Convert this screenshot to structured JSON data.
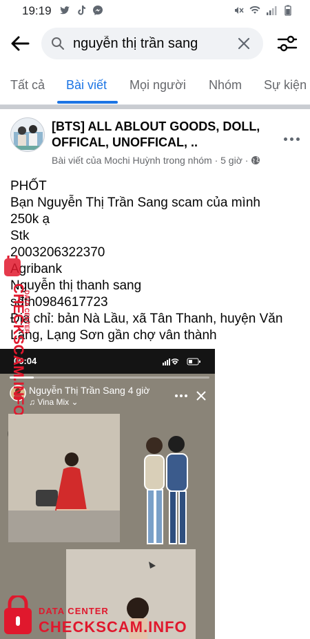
{
  "status_bar": {
    "time": "19:19"
  },
  "search": {
    "value": "nguyễn thị trần sang"
  },
  "tabs": [
    {
      "label": "Tất cả",
      "active": false
    },
    {
      "label": "Bài viết",
      "active": true
    },
    {
      "label": "Mọi người",
      "active": false
    },
    {
      "label": "Nhóm",
      "active": false
    },
    {
      "label": "Sự kiện",
      "active": false
    }
  ],
  "post": {
    "group_name": "[BTS] ALL ABLOUT GOODS, DOLL, OFFICAL, UNOFFICAL, ..",
    "meta": "Bài viết của Mochi Huỳnh trong nhóm · 5 giờ ·",
    "lines": [
      "PHỐT",
      "Bạn Nguyễn Thị Trần Sang scam của mình 250k ạ",
      "Stk",
      "2003206322370",
      "Agribank",
      "Nguyễn thị thanh sang",
      "sđth0984617723",
      "Địa chỉ: bản Nà Lầu, xã Tân Thanh, huyện Văn Lãng, Lạng Sơn gần chợ vân thành"
    ],
    "story": {
      "time": "00:04",
      "author": "Nguyễn Thị Trần Sang",
      "author_time": "4 giờ",
      "music": "♫ Vina Mix",
      "progress": 0.12
    }
  },
  "watermark": {
    "vertical": "CHECKSCAM.INFO",
    "vertical_small": "DATA CENTER",
    "small": "DATA CENTER",
    "big": "CHECKSCAM.INFO"
  },
  "colors": {
    "accent": "#1b74e4",
    "watermark": "#e0182d"
  }
}
